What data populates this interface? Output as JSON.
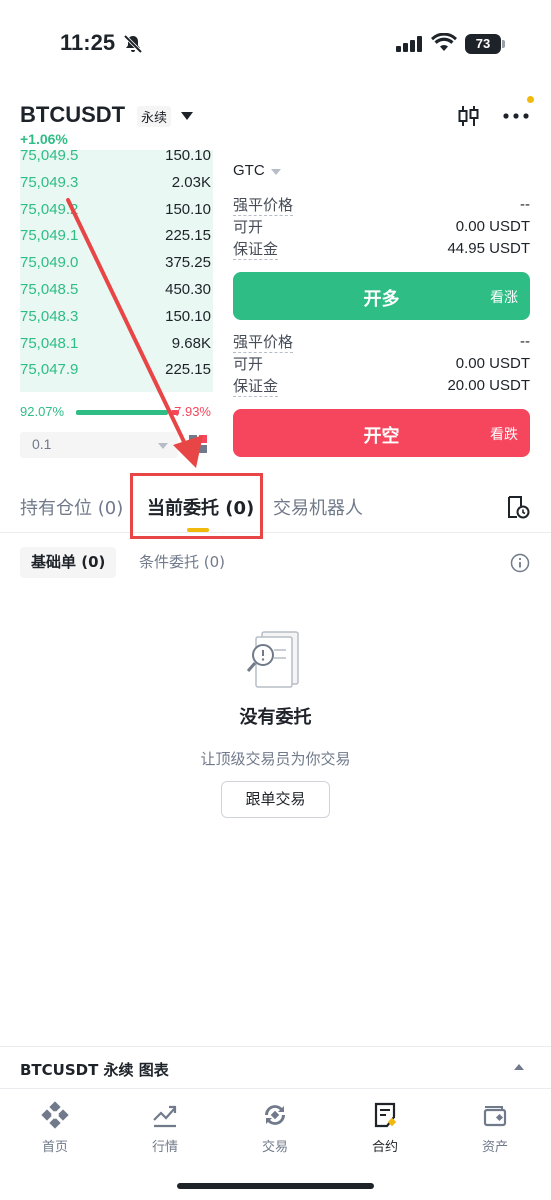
{
  "status_bar": {
    "time": "11:25",
    "battery": "73"
  },
  "header": {
    "symbol": "BTCUSDT",
    "contract_type": "永续",
    "change": "+1.06%"
  },
  "orderbook": {
    "rows": [
      {
        "price": "75,049.5",
        "qty": "150.10"
      },
      {
        "price": "75,049.3",
        "qty": "2.03K"
      },
      {
        "price": "75,049.2",
        "qty": "150.10"
      },
      {
        "price": "75,049.1",
        "qty": "225.15"
      },
      {
        "price": "75,049.0",
        "qty": "375.25"
      },
      {
        "price": "75,048.5",
        "qty": "450.30"
      },
      {
        "price": "75,048.3",
        "qty": "150.10"
      },
      {
        "price": "75,048.1",
        "qty": "9.68K"
      },
      {
        "price": "75,047.9",
        "qty": "225.15"
      }
    ],
    "buy_ratio": "92.07%",
    "sell_ratio": "7.93%",
    "buy_fraction": 0.9207,
    "depth": "0.1"
  },
  "order_form": {
    "tif": "GTC",
    "long": {
      "liq_label": "强平价格",
      "liq_value": "--",
      "avail_label": "可开",
      "avail_value": "0.00 USDT",
      "margin_label": "保证金",
      "margin_value": "44.95 USDT",
      "button": "开多",
      "button_sub": "看涨"
    },
    "short": {
      "liq_label": "强平价格",
      "liq_value": "--",
      "avail_label": "可开",
      "avail_value": "0.00 USDT",
      "margin_label": "保证金",
      "margin_value": "20.00 USDT",
      "button": "开空",
      "button_sub": "看跌"
    }
  },
  "tabs": [
    {
      "label": "持有仓位 (0)"
    },
    {
      "label": "当前委托 (0)"
    },
    {
      "label": "交易机器人"
    }
  ],
  "subtabs": [
    {
      "label": "基础单 (0)"
    },
    {
      "label": "条件委托 (0)"
    }
  ],
  "empty": {
    "title": "没有委托",
    "subtitle": "让顶级交易员为你交易",
    "button": "跟单交易"
  },
  "chart_bar": {
    "label": "BTCUSDT 永续 图表"
  },
  "bottom_nav": [
    {
      "label": "首页"
    },
    {
      "label": "行情"
    },
    {
      "label": "交易"
    },
    {
      "label": "合约"
    },
    {
      "label": "资产"
    }
  ],
  "colors": {
    "buy": "#2ebd85",
    "sell": "#f6465d",
    "accent": "#f0b90b",
    "annotation": "#e84646"
  }
}
